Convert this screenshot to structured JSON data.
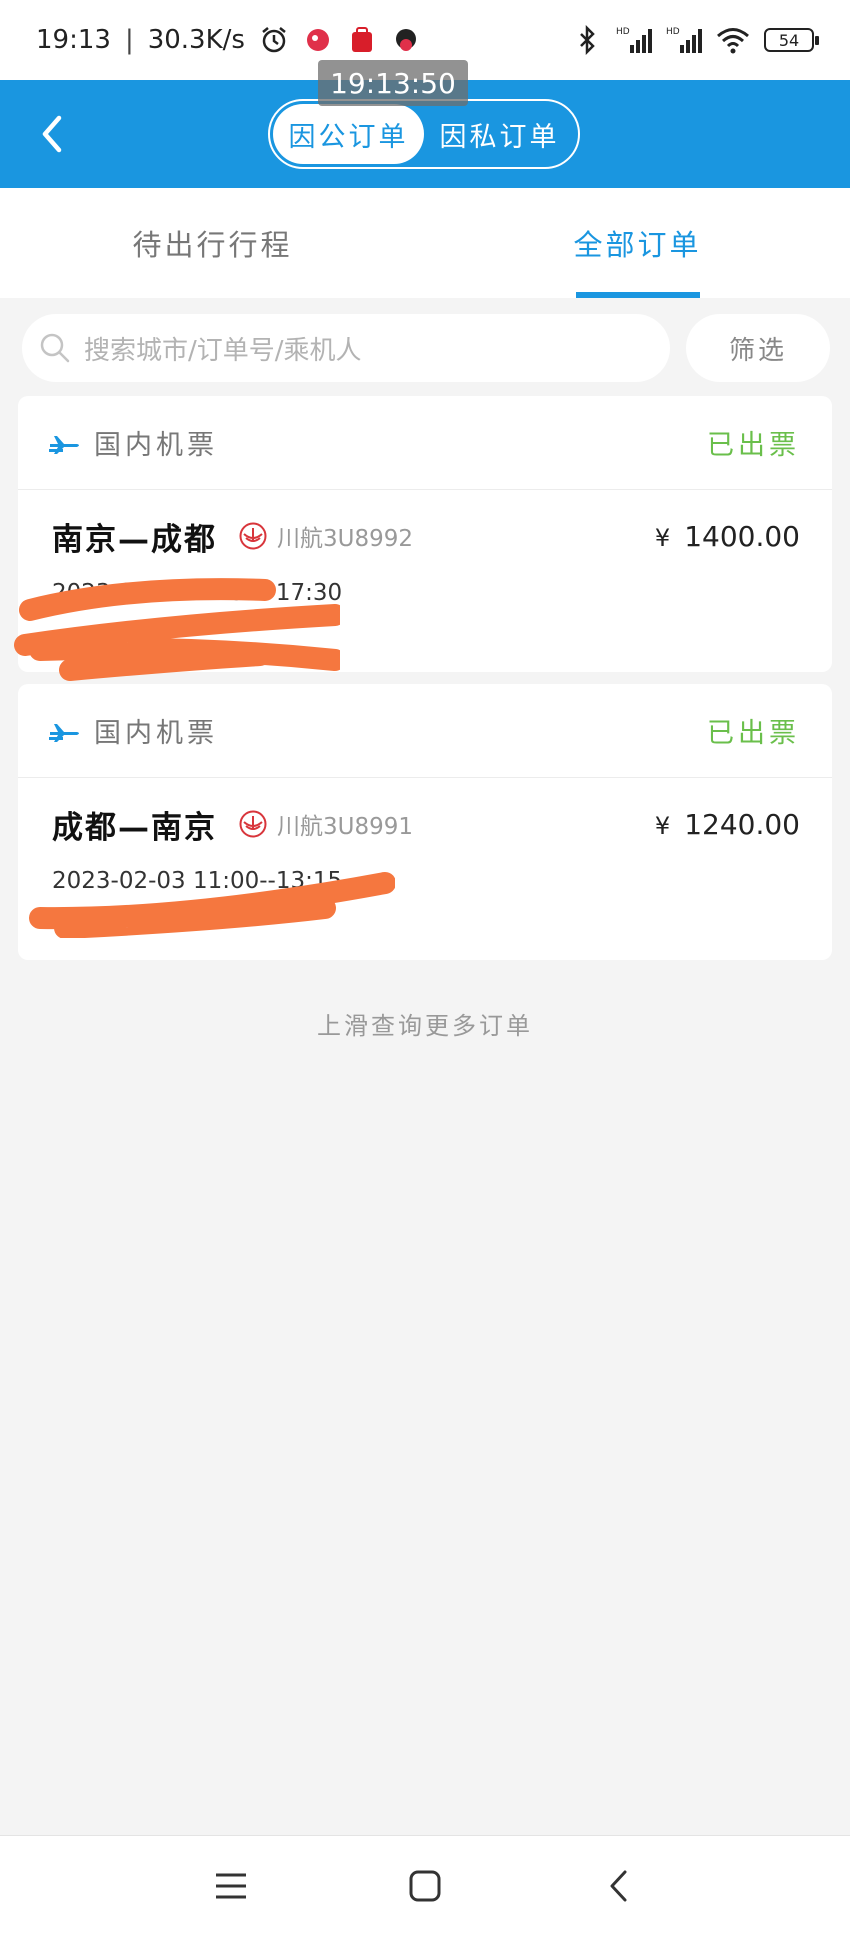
{
  "status_bar": {
    "time": "19:13",
    "separator": "|",
    "net_speed": "30.3K/s",
    "battery": "54",
    "icons": [
      "alarm-icon",
      "app-notification-icon",
      "app-notification-icon",
      "app-notification-icon",
      "bluetooth-icon",
      "signal-hd-icon",
      "signal-hd-icon",
      "wifi-icon",
      "battery-icon"
    ]
  },
  "time_overlay": "19:13:50",
  "header": {
    "back_icon": "chevron-left-icon",
    "segments": [
      {
        "label": "因公订单",
        "active": true
      },
      {
        "label": "因私订单",
        "active": false
      }
    ]
  },
  "tabs": [
    {
      "label": "待出行行程",
      "active": false
    },
    {
      "label": "全部订单",
      "active": true
    }
  ],
  "search": {
    "placeholder": "搜索城市/订单号/乘机人",
    "filter_label": "筛选"
  },
  "orders": [
    {
      "type": "国内机票",
      "status": "已出票",
      "route": "南京—成都",
      "airline": "川航3U8992",
      "currency": "¥",
      "price": "1400.00",
      "time": "2023-02-08 14:30--17:30"
    },
    {
      "type": "国内机票",
      "status": "已出票",
      "route": "成都—南京",
      "airline": "川航3U8991",
      "currency": "¥",
      "price": "1240.00",
      "time": "2023-02-03 11:00--13:15"
    }
  ],
  "more_hint": "上滑查询更多订单",
  "colors": {
    "primary": "#1a96e0",
    "status_green": "#6abf4b",
    "background": "#f4f4f4",
    "redaction": "#f5773f"
  },
  "nav": [
    "menu-icon",
    "home-icon",
    "back-icon"
  ]
}
